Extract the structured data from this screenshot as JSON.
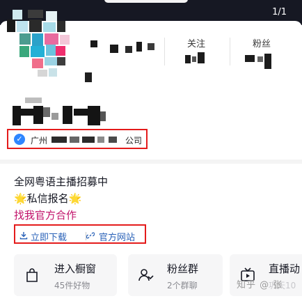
{
  "topbar": {
    "pager": "1/1"
  },
  "stats": [
    {
      "label": "关注"
    },
    {
      "label": "粉丝"
    }
  ],
  "verification": {
    "prefix": "广州",
    "suffix": "公司"
  },
  "bio": {
    "line1": "全网粤语主播招募中",
    "line2": "🌟私信报名🌟",
    "line3": "找我官方合作"
  },
  "links": {
    "download": "立即下载",
    "website": "官方网站"
  },
  "tiles": [
    {
      "title": "进入橱窗",
      "subtitle": "45件好物",
      "icon": "shopping-bag-icon"
    },
    {
      "title": "粉丝群",
      "subtitle": "2个群聊",
      "icon": "group-icon"
    },
    {
      "title": "直播动",
      "subtitle": "巩天10",
      "icon": "tv-icon"
    }
  ],
  "watermark": "知乎 @ 张",
  "colors": {
    "verify_badge": "#2f86ff",
    "link_pink": "#c1126a",
    "link_blue": "#2a62b8",
    "highlight_red": "#e41b1b",
    "topbar_dark": "#161823"
  }
}
